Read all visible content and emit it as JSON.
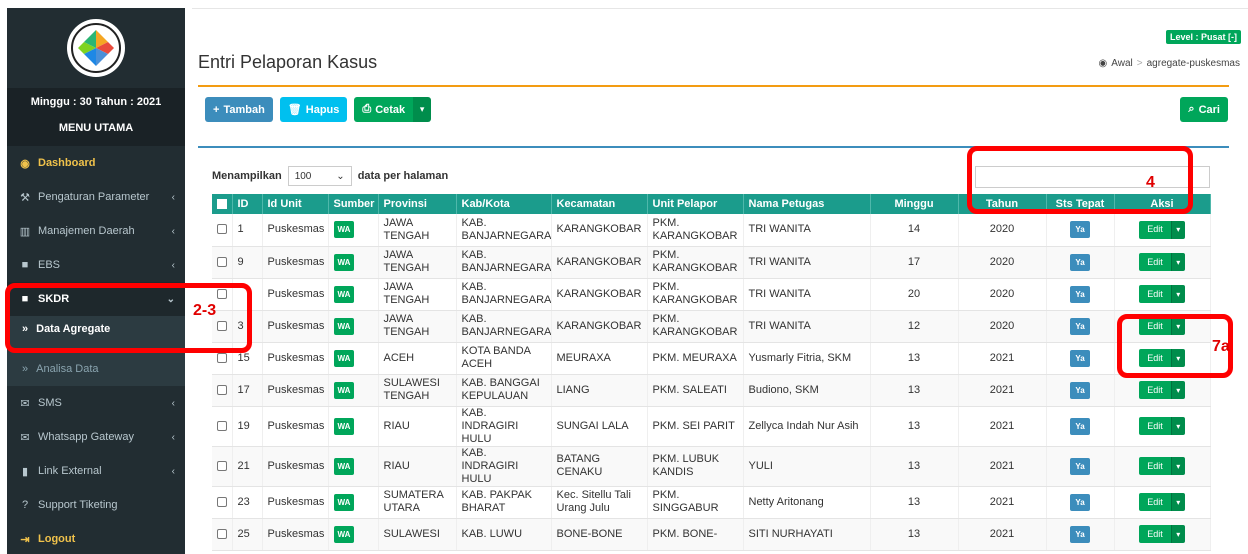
{
  "sidebar": {
    "week_year": "Minggu : 30 Tahun : 2021",
    "menu_title": "MENU UTAMA",
    "items": [
      {
        "label": "Dashboard",
        "icon": "dashboard-icon"
      },
      {
        "label": "Pengaturan Parameter",
        "icon": "wrench-icon"
      },
      {
        "label": "Manajemen Daerah",
        "icon": "map-icon"
      },
      {
        "label": "EBS",
        "icon": "folder-icon"
      },
      {
        "label": "SKDR",
        "icon": "folder-icon"
      },
      {
        "label": "SMS",
        "icon": "envelope-icon"
      },
      {
        "label": "Whatsapp Gateway",
        "icon": "envelope-icon"
      },
      {
        "label": "Link External",
        "icon": "bookmark-icon"
      },
      {
        "label": "Support Tiketing",
        "icon": "question-icon"
      },
      {
        "label": "Logout",
        "icon": "signout-icon"
      }
    ],
    "sub_active": "Data Agregate",
    "sub_other": "Analisa Data"
  },
  "header": {
    "title": "Entri Pelaporan Kasus",
    "level_badge": "Level : Pusat [-]",
    "breadcrumb_home": "Awal",
    "breadcrumb_current": "agregate-puskesmas"
  },
  "toolbar": {
    "tambah": "Tambah",
    "hapus": "Hapus",
    "cetak": "Cetak",
    "cari": "Cari"
  },
  "table_controls": {
    "show_label": "Menampilkan",
    "page_size": "100",
    "per_page_label": "data per halaman"
  },
  "table": {
    "columns": [
      "ID",
      "Id Unit",
      "Sumber",
      "Provinsi",
      "Kab/Kota",
      "Kecamatan",
      "Unit Pelapor",
      "Nama Petugas",
      "Minggu",
      "Tahun",
      "Sts Tepat",
      "Aksi"
    ],
    "rows": [
      {
        "id": "1",
        "unit": "Puskesmas",
        "sumber": "WA",
        "provinsi": "JAWA TENGAH",
        "kab": "KAB. BANJARNEGARA",
        "kec": "KARANGKOBAR",
        "pelapor": "PKM. KARANGKOBAR",
        "petugas": "TRI WANITA",
        "minggu": "14",
        "tahun": "2020",
        "sts": "Ya",
        "aksi": "Edit"
      },
      {
        "id": "9",
        "unit": "Puskesmas",
        "sumber": "WA",
        "provinsi": "JAWA TENGAH",
        "kab": "KAB. BANJARNEGARA",
        "kec": "KARANGKOBAR",
        "pelapor": "PKM. KARANGKOBAR",
        "petugas": "TRI WANITA",
        "minggu": "17",
        "tahun": "2020",
        "sts": "Ya",
        "aksi": "Edit"
      },
      {
        "id": "",
        "unit": "Puskesmas",
        "sumber": "WA",
        "provinsi": "JAWA TENGAH",
        "kab": "KAB. BANJARNEGARA",
        "kec": "KARANGKOBAR",
        "pelapor": "PKM. KARANGKOBAR",
        "petugas": "TRI WANITA",
        "minggu": "20",
        "tahun": "2020",
        "sts": "Ya",
        "aksi": "Edit"
      },
      {
        "id": "3",
        "unit": "Puskesmas",
        "sumber": "WA",
        "provinsi": "JAWA TENGAH",
        "kab": "KAB. BANJARNEGARA",
        "kec": "KARANGKOBAR",
        "pelapor": "PKM. KARANGKOBAR",
        "petugas": "TRI WANITA",
        "minggu": "12",
        "tahun": "2020",
        "sts": "Ya",
        "aksi": "Edit"
      },
      {
        "id": "15",
        "unit": "Puskesmas",
        "sumber": "WA",
        "provinsi": "ACEH",
        "kab": "KOTA BANDA ACEH",
        "kec": "MEURAXA",
        "pelapor": "PKM. MEURAXA",
        "petugas": "Yusmarly Fitria, SKM",
        "minggu": "13",
        "tahun": "2021",
        "sts": "Ya",
        "aksi": "Edit"
      },
      {
        "id": "17",
        "unit": "Puskesmas",
        "sumber": "WA",
        "provinsi": "SULAWESI TENGAH",
        "kab": "KAB. BANGGAI KEPULAUAN",
        "kec": "LIANG",
        "pelapor": "PKM. SALEATI",
        "petugas": "Budiono, SKM",
        "minggu": "13",
        "tahun": "2021",
        "sts": "Ya",
        "aksi": "Edit"
      },
      {
        "id": "19",
        "unit": "Puskesmas",
        "sumber": "WA",
        "provinsi": "RIAU",
        "kab": "KAB. INDRAGIRI HULU",
        "kec": "SUNGAI LALA",
        "pelapor": "PKM. SEI PARIT",
        "petugas": "Zellyca Indah Nur Asih",
        "minggu": "13",
        "tahun": "2021",
        "sts": "Ya",
        "aksi": "Edit"
      },
      {
        "id": "21",
        "unit": "Puskesmas",
        "sumber": "WA",
        "provinsi": "RIAU",
        "kab": "KAB. INDRAGIRI HULU",
        "kec": "BATANG CENAKU",
        "pelapor": "PKM. LUBUK KANDIS",
        "petugas": "YULI",
        "minggu": "13",
        "tahun": "2021",
        "sts": "Ya",
        "aksi": "Edit"
      },
      {
        "id": "23",
        "unit": "Puskesmas",
        "sumber": "WA",
        "provinsi": "SUMATERA UTARA",
        "kab": "KAB. PAKPAK BHARAT",
        "kec": "Kec. Sitellu Tali Urang Julu",
        "pelapor": "PKM. SINGGABUR",
        "petugas": "Netty Aritonang",
        "minggu": "13",
        "tahun": "2021",
        "sts": "Ya",
        "aksi": "Edit"
      },
      {
        "id": "25",
        "unit": "Puskesmas",
        "sumber": "WA",
        "provinsi": "SULAWESI",
        "kab": "KAB. LUWU",
        "kec": "BONE-BONE",
        "pelapor": "PKM. BONE-",
        "petugas": "SITI NURHAYATI",
        "minggu": "13",
        "tahun": "2021",
        "sts": "Ya",
        "aksi": "Edit"
      }
    ]
  },
  "annotations": {
    "a1": "2-3",
    "a2": "4",
    "a3": "7a"
  },
  "colors": {
    "sidebar_bg": "#222d32",
    "table_header": "#1b9c8c",
    "accent_orange": "#f39c12",
    "annotation_red": "#ff0000"
  }
}
